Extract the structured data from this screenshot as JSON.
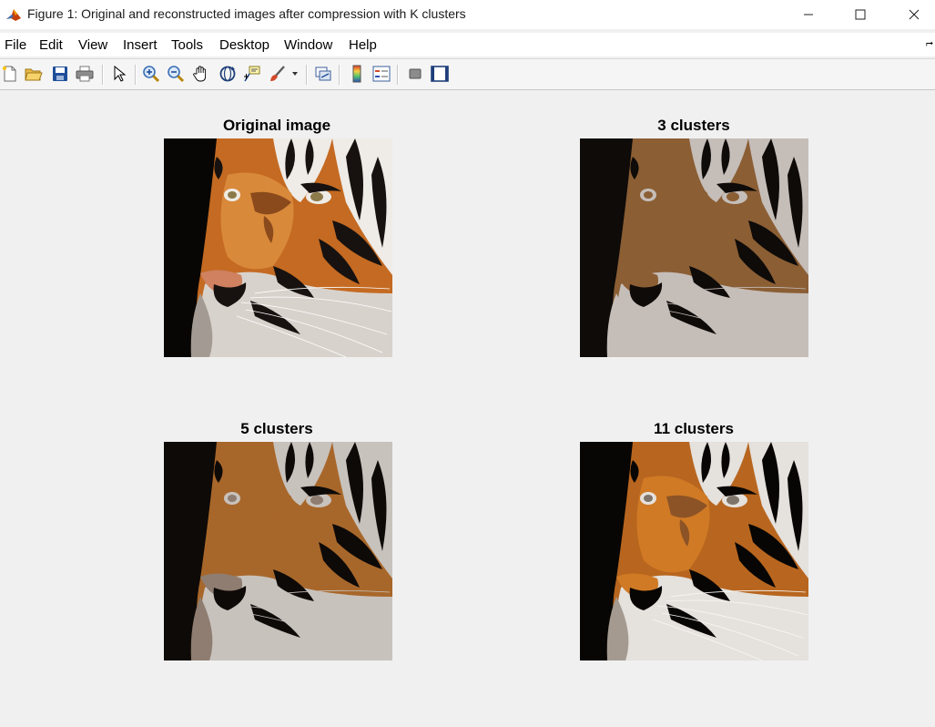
{
  "window": {
    "title": "Figure 1: Original and reconstructed images after compression with K clusters"
  },
  "menu": [
    "File",
    "Edit",
    "View",
    "Insert",
    "Tools",
    "Desktop",
    "Window",
    "Help"
  ],
  "toolbar": {
    "icons": [
      "new-figure-icon",
      "open-file-icon",
      "save-icon",
      "print-icon",
      "select-arrow-icon",
      "zoom-in-icon",
      "zoom-out-icon",
      "pan-hand-icon",
      "rotate-3d-icon",
      "data-cursor-icon",
      "brush-icon",
      "link-plot-icon",
      "colorbar-icon",
      "legend-icon",
      "hide-plot-tools-icon",
      "show-plot-tools-icon"
    ]
  },
  "figure": {
    "panels": [
      {
        "title": "Original image",
        "palette": "original"
      },
      {
        "title": "3 clusters",
        "palette": "k3"
      },
      {
        "title": "5 clusters",
        "palette": "k5"
      },
      {
        "title": "11 clusters",
        "palette": "k11"
      }
    ]
  },
  "colors": {
    "k3": [
      "#0e0b09",
      "#8b5e34",
      "#c5bdb8"
    ],
    "k5": [
      "#0e0a08",
      "#5a4a3c",
      "#a8672a",
      "#c8c2bd",
      "#8e7d70"
    ],
    "k11": [
      "#080604",
      "#2c241d",
      "#5b3b1f",
      "#8c5326",
      "#b8661f",
      "#d07a25",
      "#7e7469",
      "#a49a90",
      "#c8c1ba",
      "#e5e1dd",
      "#f8f7f5"
    ]
  }
}
